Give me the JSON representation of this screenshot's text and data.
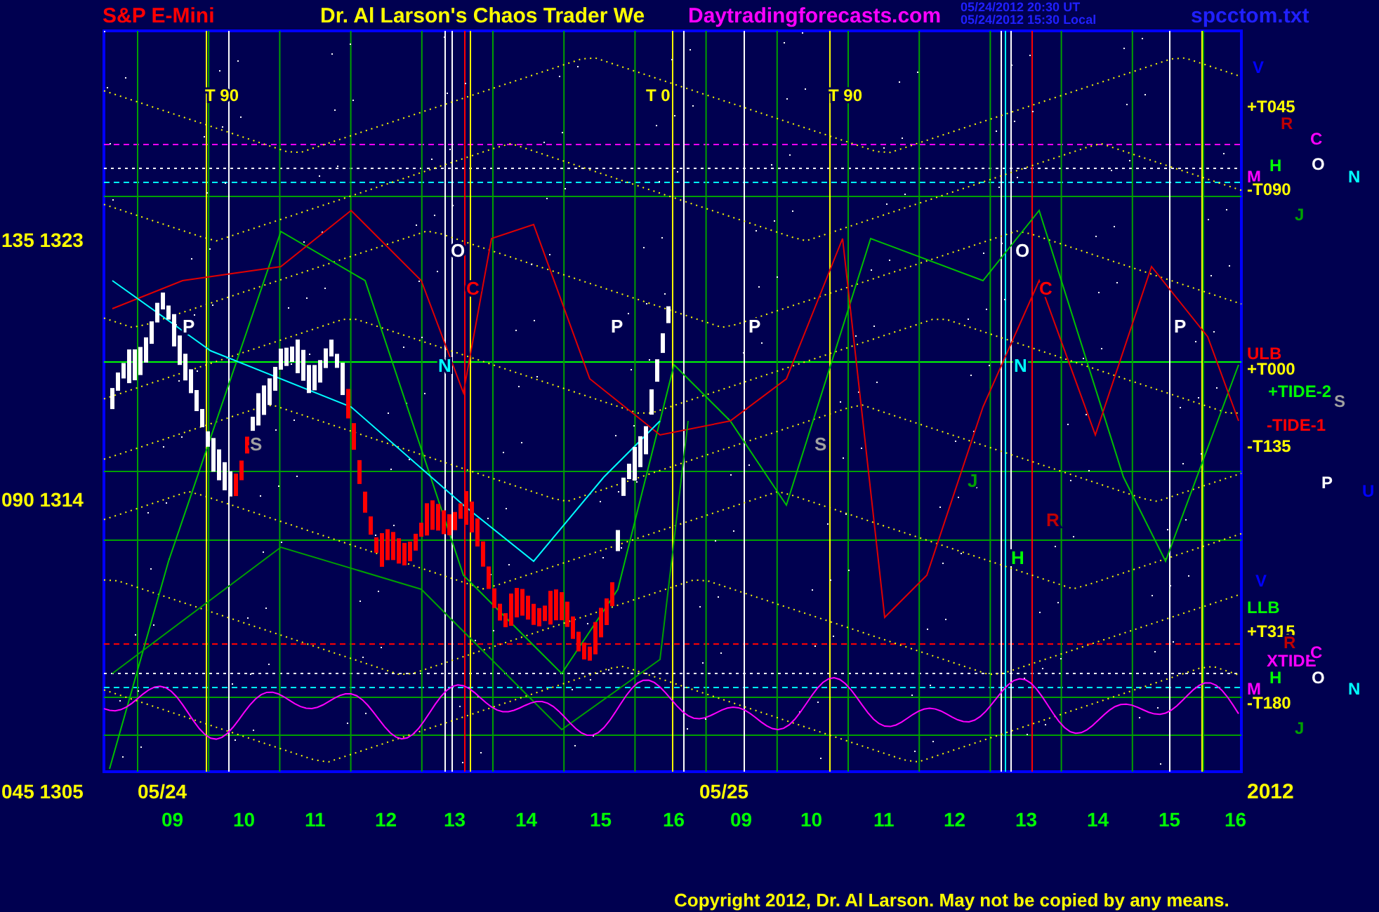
{
  "header": {
    "instrument": "S&P E-Mini",
    "title": "Dr. Al Larson's Chaos Trader We",
    "site": "Daytradingforecasts.com",
    "time_ut": "05/24/2012 20:30 UT",
    "time_local": "05/24/2012 15:30 Local",
    "file": "spcctom.txt"
  },
  "chart": {
    "price_labels": [
      "135 1323",
      "090 1314",
      "045 1305"
    ],
    "time_labels": [
      "09",
      "10",
      "11",
      "12",
      "13",
      "14",
      "15",
      "16",
      "09",
      "10",
      "11",
      "12",
      "13",
      "14",
      "15",
      "16"
    ],
    "date_labels": [
      "05/24",
      "05/25"
    ],
    "year": "2012",
    "cycle_markers": [
      "T 90",
      "T 0",
      "T 90"
    ],
    "planet_markers": [
      {
        "text": "O",
        "color": "#ffffff"
      },
      {
        "text": "C",
        "color": "#ff0000"
      },
      {
        "text": "P",
        "color": "#ffffff"
      },
      {
        "text": "N",
        "color": "#00ffff"
      },
      {
        "text": "S",
        "color": "#a0a0a0"
      },
      {
        "text": "P",
        "color": "#ffffff"
      },
      {
        "text": "P",
        "color": "#ffffff"
      },
      {
        "text": "S",
        "color": "#a0a0a0"
      },
      {
        "text": "O",
        "color": "#ffffff"
      },
      {
        "text": "C",
        "color": "#ff0000"
      },
      {
        "text": "N",
        "color": "#00ffff"
      },
      {
        "text": "P",
        "color": "#ffffff"
      },
      {
        "text": "J",
        "color": "#00a000"
      },
      {
        "text": "R",
        "color": "#c00000"
      },
      {
        "text": "H",
        "color": "#00ff00"
      }
    ],
    "right_labels": [
      {
        "text": "V",
        "color": "#0000ff"
      },
      {
        "text": "+T045",
        "color": "#ffff00"
      },
      {
        "text": "R",
        "color": "#c00000"
      },
      {
        "text": "C",
        "color": "#ff00ff"
      },
      {
        "text": "H",
        "color": "#00ff00"
      },
      {
        "text": "O",
        "color": "#ffffff"
      },
      {
        "text": "N",
        "color": "#00ffff"
      },
      {
        "text": "M",
        "color": "#ff00ff"
      },
      {
        "text": "-T090",
        "color": "#ffff00"
      },
      {
        "text": "J",
        "color": "#00a000"
      },
      {
        "text": "ULB",
        "color": "#ff0000"
      },
      {
        "text": "+T000",
        "color": "#ffff00"
      },
      {
        "text": "+TIDE-2",
        "color": "#00ff00"
      },
      {
        "text": "S",
        "color": "#a0a0a0"
      },
      {
        "text": "-TIDE-1",
        "color": "#ff0000"
      },
      {
        "text": "-T135",
        "color": "#ffff00"
      },
      {
        "text": "P",
        "color": "#ffffff"
      },
      {
        "text": "U",
        "color": "#0000ff"
      },
      {
        "text": "V",
        "color": "#0000ff"
      },
      {
        "text": "LLB",
        "color": "#00ff00"
      },
      {
        "text": "+T315",
        "color": "#ffff00"
      },
      {
        "text": "R",
        "color": "#c00000"
      },
      {
        "text": "XTIDE",
        "color": "#ff00ff"
      },
      {
        "text": "C",
        "color": "#ff00ff"
      },
      {
        "text": "H",
        "color": "#00ff00"
      },
      {
        "text": "O",
        "color": "#ffffff"
      },
      {
        "text": "N",
        "color": "#00ffff"
      },
      {
        "text": "M",
        "color": "#ff00ff"
      },
      {
        "text": "-T180",
        "color": "#ffff00"
      },
      {
        "text": "J",
        "color": "#00a000"
      }
    ]
  },
  "footer": {
    "copyright": "Copyright 2012, Dr. Al Larson. May not be copied by any means."
  }
}
